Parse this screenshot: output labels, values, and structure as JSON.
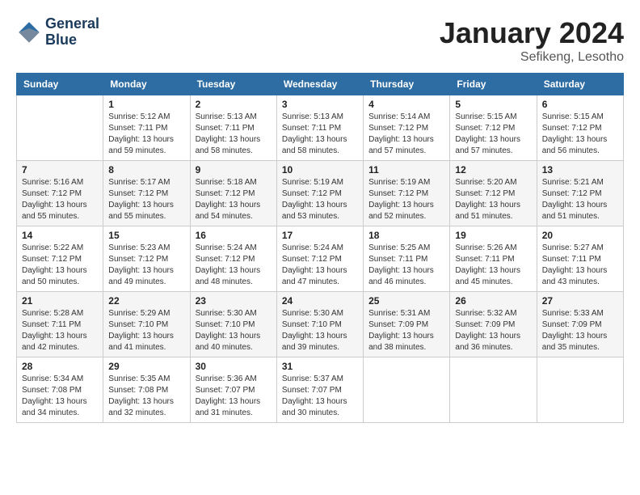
{
  "header": {
    "logo_line1": "General",
    "logo_line2": "Blue",
    "month_year": "January 2024",
    "location": "Sefikeng, Lesotho"
  },
  "columns": [
    "Sunday",
    "Monday",
    "Tuesday",
    "Wednesday",
    "Thursday",
    "Friday",
    "Saturday"
  ],
  "weeks": [
    [
      {
        "day": "",
        "sunrise": "",
        "sunset": "",
        "daylight": ""
      },
      {
        "day": "1",
        "sunrise": "Sunrise: 5:12 AM",
        "sunset": "Sunset: 7:11 PM",
        "daylight": "Daylight: 13 hours and 59 minutes."
      },
      {
        "day": "2",
        "sunrise": "Sunrise: 5:13 AM",
        "sunset": "Sunset: 7:11 PM",
        "daylight": "Daylight: 13 hours and 58 minutes."
      },
      {
        "day": "3",
        "sunrise": "Sunrise: 5:13 AM",
        "sunset": "Sunset: 7:11 PM",
        "daylight": "Daylight: 13 hours and 58 minutes."
      },
      {
        "day": "4",
        "sunrise": "Sunrise: 5:14 AM",
        "sunset": "Sunset: 7:12 PM",
        "daylight": "Daylight: 13 hours and 57 minutes."
      },
      {
        "day": "5",
        "sunrise": "Sunrise: 5:15 AM",
        "sunset": "Sunset: 7:12 PM",
        "daylight": "Daylight: 13 hours and 57 minutes."
      },
      {
        "day": "6",
        "sunrise": "Sunrise: 5:15 AM",
        "sunset": "Sunset: 7:12 PM",
        "daylight": "Daylight: 13 hours and 56 minutes."
      }
    ],
    [
      {
        "day": "7",
        "sunrise": "Sunrise: 5:16 AM",
        "sunset": "Sunset: 7:12 PM",
        "daylight": "Daylight: 13 hours and 55 minutes."
      },
      {
        "day": "8",
        "sunrise": "Sunrise: 5:17 AM",
        "sunset": "Sunset: 7:12 PM",
        "daylight": "Daylight: 13 hours and 55 minutes."
      },
      {
        "day": "9",
        "sunrise": "Sunrise: 5:18 AM",
        "sunset": "Sunset: 7:12 PM",
        "daylight": "Daylight: 13 hours and 54 minutes."
      },
      {
        "day": "10",
        "sunrise": "Sunrise: 5:19 AM",
        "sunset": "Sunset: 7:12 PM",
        "daylight": "Daylight: 13 hours and 53 minutes."
      },
      {
        "day": "11",
        "sunrise": "Sunrise: 5:19 AM",
        "sunset": "Sunset: 7:12 PM",
        "daylight": "Daylight: 13 hours and 52 minutes."
      },
      {
        "day": "12",
        "sunrise": "Sunrise: 5:20 AM",
        "sunset": "Sunset: 7:12 PM",
        "daylight": "Daylight: 13 hours and 51 minutes."
      },
      {
        "day": "13",
        "sunrise": "Sunrise: 5:21 AM",
        "sunset": "Sunset: 7:12 PM",
        "daylight": "Daylight: 13 hours and 51 minutes."
      }
    ],
    [
      {
        "day": "14",
        "sunrise": "Sunrise: 5:22 AM",
        "sunset": "Sunset: 7:12 PM",
        "daylight": "Daylight: 13 hours and 50 minutes."
      },
      {
        "day": "15",
        "sunrise": "Sunrise: 5:23 AM",
        "sunset": "Sunset: 7:12 PM",
        "daylight": "Daylight: 13 hours and 49 minutes."
      },
      {
        "day": "16",
        "sunrise": "Sunrise: 5:24 AM",
        "sunset": "Sunset: 7:12 PM",
        "daylight": "Daylight: 13 hours and 48 minutes."
      },
      {
        "day": "17",
        "sunrise": "Sunrise: 5:24 AM",
        "sunset": "Sunset: 7:12 PM",
        "daylight": "Daylight: 13 hours and 47 minutes."
      },
      {
        "day": "18",
        "sunrise": "Sunrise: 5:25 AM",
        "sunset": "Sunset: 7:11 PM",
        "daylight": "Daylight: 13 hours and 46 minutes."
      },
      {
        "day": "19",
        "sunrise": "Sunrise: 5:26 AM",
        "sunset": "Sunset: 7:11 PM",
        "daylight": "Daylight: 13 hours and 45 minutes."
      },
      {
        "day": "20",
        "sunrise": "Sunrise: 5:27 AM",
        "sunset": "Sunset: 7:11 PM",
        "daylight": "Daylight: 13 hours and 43 minutes."
      }
    ],
    [
      {
        "day": "21",
        "sunrise": "Sunrise: 5:28 AM",
        "sunset": "Sunset: 7:11 PM",
        "daylight": "Daylight: 13 hours and 42 minutes."
      },
      {
        "day": "22",
        "sunrise": "Sunrise: 5:29 AM",
        "sunset": "Sunset: 7:10 PM",
        "daylight": "Daylight: 13 hours and 41 minutes."
      },
      {
        "day": "23",
        "sunrise": "Sunrise: 5:30 AM",
        "sunset": "Sunset: 7:10 PM",
        "daylight": "Daylight: 13 hours and 40 minutes."
      },
      {
        "day": "24",
        "sunrise": "Sunrise: 5:30 AM",
        "sunset": "Sunset: 7:10 PM",
        "daylight": "Daylight: 13 hours and 39 minutes."
      },
      {
        "day": "25",
        "sunrise": "Sunrise: 5:31 AM",
        "sunset": "Sunset: 7:09 PM",
        "daylight": "Daylight: 13 hours and 38 minutes."
      },
      {
        "day": "26",
        "sunrise": "Sunrise: 5:32 AM",
        "sunset": "Sunset: 7:09 PM",
        "daylight": "Daylight: 13 hours and 36 minutes."
      },
      {
        "day": "27",
        "sunrise": "Sunrise: 5:33 AM",
        "sunset": "Sunset: 7:09 PM",
        "daylight": "Daylight: 13 hours and 35 minutes."
      }
    ],
    [
      {
        "day": "28",
        "sunrise": "Sunrise: 5:34 AM",
        "sunset": "Sunset: 7:08 PM",
        "daylight": "Daylight: 13 hours and 34 minutes."
      },
      {
        "day": "29",
        "sunrise": "Sunrise: 5:35 AM",
        "sunset": "Sunset: 7:08 PM",
        "daylight": "Daylight: 13 hours and 32 minutes."
      },
      {
        "day": "30",
        "sunrise": "Sunrise: 5:36 AM",
        "sunset": "Sunset: 7:07 PM",
        "daylight": "Daylight: 13 hours and 31 minutes."
      },
      {
        "day": "31",
        "sunrise": "Sunrise: 5:37 AM",
        "sunset": "Sunset: 7:07 PM",
        "daylight": "Daylight: 13 hours and 30 minutes."
      },
      {
        "day": "",
        "sunrise": "",
        "sunset": "",
        "daylight": ""
      },
      {
        "day": "",
        "sunrise": "",
        "sunset": "",
        "daylight": ""
      },
      {
        "day": "",
        "sunrise": "",
        "sunset": "",
        "daylight": ""
      }
    ]
  ],
  "row_shading": [
    false,
    true,
    false,
    true,
    false
  ]
}
